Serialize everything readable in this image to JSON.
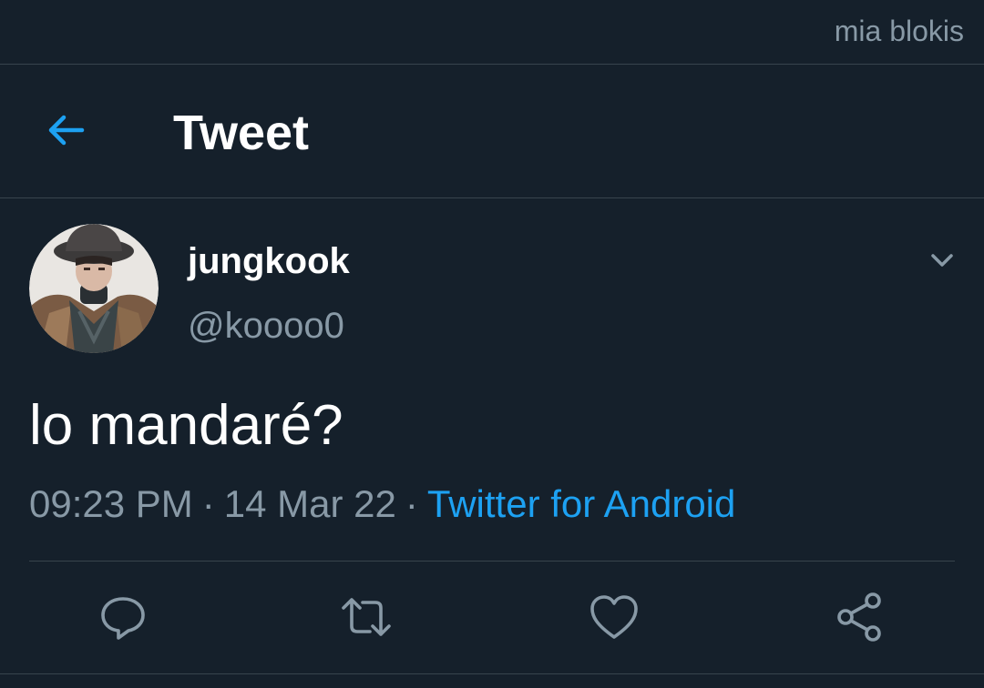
{
  "watermark": "mia blokis",
  "header": {
    "title": "Tweet",
    "back_icon": "arrow-left-icon"
  },
  "author": {
    "display_name": "jungkook",
    "handle": "@koooo0"
  },
  "tweet": {
    "text": "lo mandaré?",
    "time": "09:23 PM",
    "date": "14 Mar 22",
    "separator": "·",
    "source": "Twitter for Android"
  },
  "actions": {
    "icons": [
      "reply-icon",
      "retweet-icon",
      "like-icon",
      "share-icon"
    ]
  },
  "colors": {
    "background": "#15202b",
    "accent": "#1da1f2",
    "secondary_text": "#8899a6",
    "border": "#38444d"
  }
}
